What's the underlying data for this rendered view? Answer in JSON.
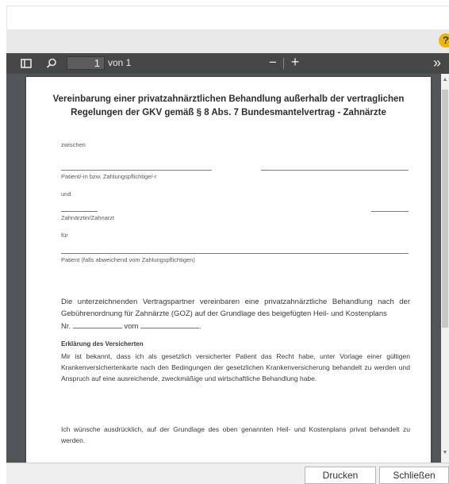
{
  "toolbar": {
    "sidebar_icon": "sidebar-toggle-icon",
    "search_icon": "search-icon",
    "page_number": "1",
    "page_of": "von 1",
    "zoom_out": "−",
    "zoom_in": "+",
    "more": "»"
  },
  "help": {
    "icon": "help-icon",
    "label": "?",
    "color": "#f0b400"
  },
  "document": {
    "title_line1": "Vereinbarung einer privatzahnärztlichen Behandlung außerhalb der vertraglichen",
    "title_line2": "Regelungen der GKV gemäß § 8 Abs. 7 Bundesmantelvertrag - Zahnärzte",
    "zwischen": "zwischen",
    "patient_label": "Patient/-in bzw. Zahlungspflichtige/-r",
    "und": "und",
    "dentist_label": "Zahnärztin/Zahnarzt",
    "fuer": "für",
    "patient_alt_label": "Patient (falls abweichend vom Zahlungspflichtigen)",
    "agreement_text": "Die unterzeichnenden Vertragspartner vereinbaren eine privatzahnärztliche Behandlung nach der Gebührenordnung für Zahnärzte (GOZ) auf der Grundlage des beigefügten Heil- und Kostenplans",
    "nr_label": "Nr.",
    "vom_label": "vom",
    "period": ".",
    "section_heading": "Erklärung des Versicherten",
    "declaration_text": "Mir ist bekannt, dass ich als gesetzlich versicherter Patient das Recht habe, unter Vorlage einer gültigen Krankenversichertenkarte nach den Bedingungen der gesetzlichen Krankenversicherung behandelt zu werden und Anspruch auf eine ausreichende, zweckmäßige und wirtschaftliche Behandlung habe.",
    "wish_text": "Ich wünsche ausdrücklich, auf der Grundlage des oben genannten Heil- und Kostenplans privat behandelt zu werden."
  },
  "buttons": {
    "print": "Drucken",
    "close": "Schließen"
  },
  "colors": {
    "toolbar": "#474747",
    "viewer": "#525659",
    "page": "#ffffff"
  }
}
